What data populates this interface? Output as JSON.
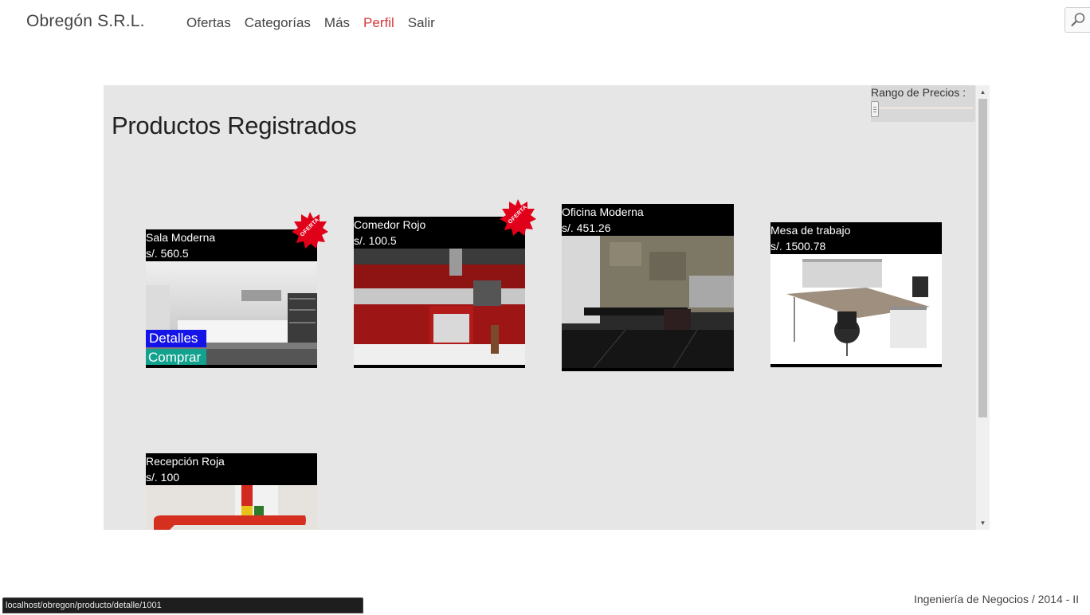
{
  "header": {
    "brand": "Obregón S.R.L.",
    "nav": [
      "Ofertas",
      "Categorías",
      "Más",
      "Perfil",
      "Salir"
    ],
    "active_item": "Perfil",
    "search_icon": "magnifier-icon"
  },
  "main": {
    "title": "Productos Registrados",
    "price_filter": {
      "label": "Rango de Precios :",
      "value": 0
    },
    "products": [
      {
        "name": "Sala Moderna",
        "price": "s/. 560.5",
        "badge": "OFERTA",
        "actions": [
          "Detalles",
          "Comprar"
        ]
      },
      {
        "name": "Comedor Rojo",
        "price": "s/. 100.5",
        "badge": "OFERTA"
      },
      {
        "name": "Oficina Moderna",
        "price": "s/. 451.26"
      },
      {
        "name": "Mesa de trabajo",
        "price": "s/. 1500.78"
      },
      {
        "name": "Recepción Roja",
        "price": "s/. 100"
      }
    ]
  },
  "status_url": "localhost/obregon/producto/detalle/1001",
  "footer": "Ingeniería de Negocios / 2014 - II",
  "colors": {
    "accent": "#d9383a",
    "detalles_button": "#1414e8",
    "comprar_button": "#12a28e",
    "panel_bg": "#e6e6e6"
  }
}
